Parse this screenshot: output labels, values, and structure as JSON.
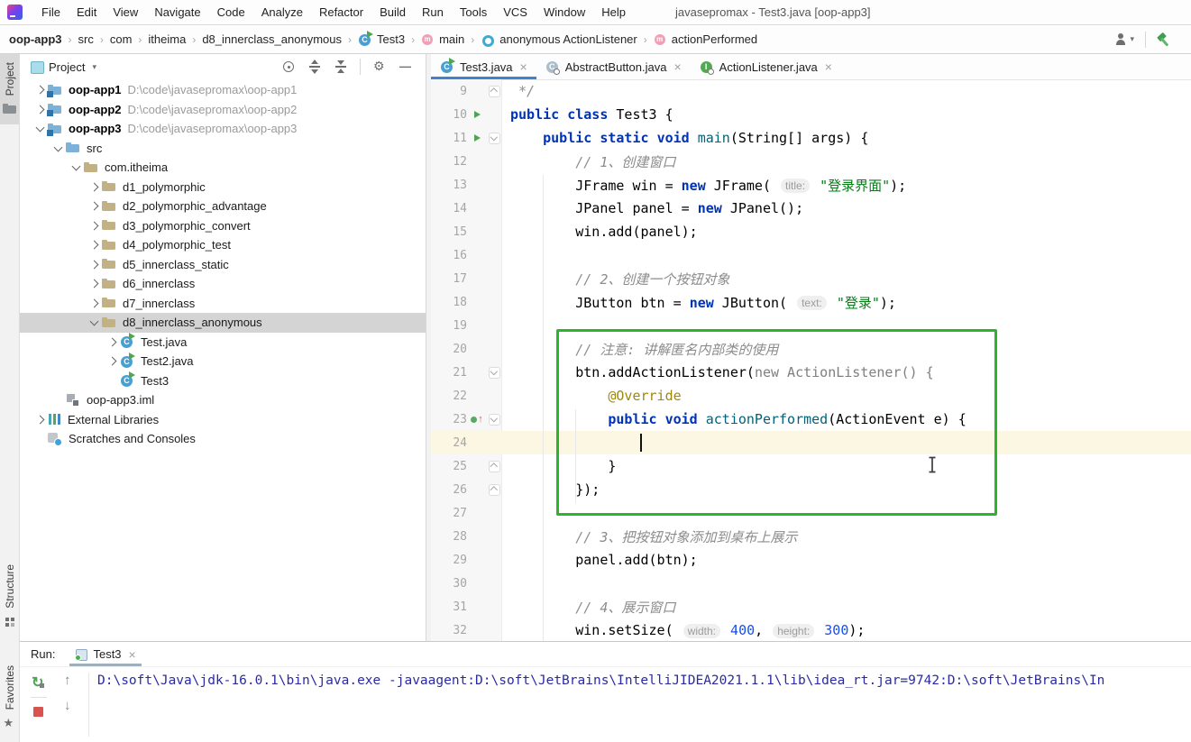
{
  "window": {
    "title": "javasepromax - Test3.java [oop-app3]"
  },
  "menu": {
    "items": [
      "File",
      "Edit",
      "View",
      "Navigate",
      "Code",
      "Analyze",
      "Refactor",
      "Build",
      "Run",
      "Tools",
      "VCS",
      "Window",
      "Help"
    ]
  },
  "breadcrumbs": {
    "items": [
      {
        "label": "oop-app3",
        "icon": null,
        "bold": true
      },
      {
        "label": "src",
        "icon": null
      },
      {
        "label": "com",
        "icon": null
      },
      {
        "label": "itheima",
        "icon": null
      },
      {
        "label": "d8_innerclass_anonymous",
        "icon": null
      },
      {
        "label": "Test3",
        "icon": "class-run"
      },
      {
        "label": "main",
        "icon": "method"
      },
      {
        "label": "anonymous ActionListener",
        "icon": "anonymous-class"
      },
      {
        "label": "actionPerformed",
        "icon": "method"
      }
    ],
    "actions": [
      "user",
      "separator",
      "build-hammer"
    ]
  },
  "stripes": {
    "left_top": [
      {
        "label": "Project",
        "icon": "gray-folder",
        "selected": true
      }
    ],
    "left_bottom": [
      {
        "label": "Structure",
        "icon": "structure"
      },
      {
        "label": "Favorites",
        "icon": "star"
      }
    ]
  },
  "project_panel": {
    "title": "Project",
    "title_caret": "▾",
    "toolbar": [
      "locate",
      "expand-all",
      "collapse-all",
      "separator",
      "settings",
      "hide"
    ],
    "tree": [
      {
        "level": 0,
        "chev": "right",
        "icon": "module",
        "label": "oop-app1",
        "bold": true,
        "path": "D:\\code\\javasepromax\\oop-app1"
      },
      {
        "level": 0,
        "chev": "right",
        "icon": "module",
        "label": "oop-app2",
        "bold": true,
        "path": "D:\\code\\javasepromax\\oop-app2"
      },
      {
        "level": 0,
        "chev": "down",
        "icon": "module",
        "label": "oop-app3",
        "bold": true,
        "path": "D:\\code\\javasepromax\\oop-app3"
      },
      {
        "level": 1,
        "chev": "down",
        "icon": "folder",
        "label": "src"
      },
      {
        "level": 2,
        "chev": "down",
        "icon": "package",
        "label": "com.itheima"
      },
      {
        "level": 3,
        "chev": "right",
        "icon": "package",
        "label": "d1_polymorphic"
      },
      {
        "level": 3,
        "chev": "right",
        "icon": "package",
        "label": "d2_polymorphic_advantage"
      },
      {
        "level": 3,
        "chev": "right",
        "icon": "package",
        "label": "d3_polymorphic_convert"
      },
      {
        "level": 3,
        "chev": "right",
        "icon": "package",
        "label": "d4_polymorphic_test"
      },
      {
        "level": 3,
        "chev": "right",
        "icon": "package",
        "label": "d5_innerclass_static"
      },
      {
        "level": 3,
        "chev": "right",
        "icon": "package",
        "label": "d6_innerclass"
      },
      {
        "level": 3,
        "chev": "right",
        "icon": "package",
        "label": "d7_innerclass"
      },
      {
        "level": 3,
        "chev": "down",
        "icon": "package",
        "label": "d8_innerclass_anonymous",
        "selected": true
      },
      {
        "level": 4,
        "chev": "right",
        "icon": "class-run",
        "label": "Test.java"
      },
      {
        "level": 4,
        "chev": "right",
        "icon": "class-run",
        "label": "Test2.java"
      },
      {
        "level": 4,
        "chev": null,
        "icon": "class-run",
        "label": "Test3"
      },
      {
        "level": 1,
        "chev": null,
        "icon": "iml",
        "label": "oop-app3.iml"
      },
      {
        "level": 0,
        "chev": "right",
        "icon": "libs",
        "label": "External Libraries"
      },
      {
        "level": 0,
        "chev": null,
        "icon": "scratches",
        "label": "Scratches and Consoles"
      }
    ]
  },
  "editor": {
    "tabs": [
      {
        "label": "Test3.java",
        "icon": "class-run",
        "selected": true,
        "close": "×"
      },
      {
        "label": "AbstractButton.java",
        "icon": "abstract-class",
        "selected": false,
        "close": "×"
      },
      {
        "label": "ActionListener.java",
        "icon": "interface",
        "selected": false,
        "close": "×"
      }
    ],
    "caret": {
      "line": 24,
      "col": 16
    },
    "lines": [
      {
        "num": 9,
        "fold": "up",
        "tokens": [
          [
            " */",
            "comment"
          ]
        ]
      },
      {
        "num": 10,
        "run": true,
        "tokens": [
          [
            "public",
            "kw"
          ],
          [
            " ",
            "plain"
          ],
          [
            "class",
            "kw"
          ],
          [
            " Test3 {",
            "plain"
          ]
        ]
      },
      {
        "num": 11,
        "run": true,
        "fold": "down",
        "tokens": [
          [
            "    ",
            "plain"
          ],
          [
            "public",
            "kw"
          ],
          [
            " ",
            "plain"
          ],
          [
            "static",
            "kw"
          ],
          [
            " ",
            "plain"
          ],
          [
            "void",
            "kw"
          ],
          [
            " ",
            "plain"
          ],
          [
            "main",
            "method"
          ],
          [
            "(String[] args) {",
            "plain"
          ]
        ]
      },
      {
        "num": 12,
        "tokens": [
          [
            "        ",
            "plain"
          ],
          [
            "// 1、创建窗口",
            "comment"
          ]
        ]
      },
      {
        "num": 13,
        "tokens": [
          [
            "        JFrame win = ",
            "plain"
          ],
          [
            "new",
            "kw"
          ],
          [
            " JFrame( ",
            "plain"
          ],
          [
            "title:",
            "badge"
          ],
          [
            " ",
            "plain"
          ],
          [
            "\"登录界面\"",
            "str"
          ],
          [
            ");",
            "plain"
          ]
        ]
      },
      {
        "num": 14,
        "tokens": [
          [
            "        JPanel panel = ",
            "plain"
          ],
          [
            "new",
            "kw"
          ],
          [
            " JPanel();",
            "plain"
          ]
        ]
      },
      {
        "num": 15,
        "tokens": [
          [
            "        win.add(panel);",
            "plain"
          ]
        ]
      },
      {
        "num": 16,
        "tokens": []
      },
      {
        "num": 17,
        "tokens": [
          [
            "        ",
            "plain"
          ],
          [
            "// 2、创建一个按钮对象",
            "comment"
          ]
        ]
      },
      {
        "num": 18,
        "tokens": [
          [
            "        JButton btn = ",
            "plain"
          ],
          [
            "new",
            "kw"
          ],
          [
            " JButton( ",
            "plain"
          ],
          [
            "text:",
            "badge"
          ],
          [
            " ",
            "plain"
          ],
          [
            "\"登录\"",
            "str"
          ],
          [
            ");",
            "plain"
          ]
        ]
      },
      {
        "num": 19,
        "tokens": []
      },
      {
        "num": 20,
        "tokens": [
          [
            "        ",
            "plain"
          ],
          [
            "// 注意: 讲解匿名内部类的使用",
            "comment"
          ]
        ]
      },
      {
        "num": 21,
        "fold": "down",
        "tokens": [
          [
            "        btn.addActionListener(",
            "plain"
          ],
          [
            "new ActionListener() {",
            "gray"
          ]
        ]
      },
      {
        "num": 22,
        "tokens": [
          [
            "            ",
            "plain"
          ],
          [
            "@Override",
            "ann"
          ]
        ]
      },
      {
        "num": 23,
        "override": true,
        "fold": "down",
        "tokens": [
          [
            "            ",
            "plain"
          ],
          [
            "public",
            "kw"
          ],
          [
            " ",
            "plain"
          ],
          [
            "void",
            "kw"
          ],
          [
            " ",
            "plain"
          ],
          [
            "actionPerformed",
            "method"
          ],
          [
            "(ActionEvent e) {",
            "plain"
          ]
        ]
      },
      {
        "num": 24,
        "current": true,
        "tokens": []
      },
      {
        "num": 25,
        "fold": "up",
        "tokens": [
          [
            "            }",
            "plain"
          ]
        ]
      },
      {
        "num": 26,
        "fold": "up",
        "tokens": [
          [
            "        });",
            "plain"
          ]
        ]
      },
      {
        "num": 27,
        "tokens": []
      },
      {
        "num": 28,
        "tokens": [
          [
            "        ",
            "plain"
          ],
          [
            "// 3、把按钮对象添加到桌布上展示",
            "comment"
          ]
        ]
      },
      {
        "num": 29,
        "tokens": [
          [
            "        panel.add(btn);",
            "plain"
          ]
        ]
      },
      {
        "num": 30,
        "tokens": []
      },
      {
        "num": 31,
        "tokens": [
          [
            "        ",
            "plain"
          ],
          [
            "// 4、展示窗口",
            "comment"
          ]
        ]
      },
      {
        "num": 32,
        "tokens": [
          [
            "        win.setSize( ",
            "plain"
          ],
          [
            "width:",
            "badge"
          ],
          [
            " ",
            "plain"
          ],
          [
            "400",
            "num"
          ],
          [
            ", ",
            "plain"
          ],
          [
            "height:",
            "badge"
          ],
          [
            " ",
            "plain"
          ],
          [
            "300",
            "num"
          ],
          [
            ");",
            "plain"
          ]
        ]
      }
    ]
  },
  "annotation": {
    "shape": "green-rectangle",
    "color": "#2bb52b"
  },
  "run_panel": {
    "label": "Run:",
    "tab": {
      "label": "Test3",
      "icon": "run-console",
      "close": "×"
    },
    "toolbar_left": [
      "rerun",
      "stop"
    ],
    "toolbar_right": [
      "up",
      "down"
    ],
    "console": "D:\\soft\\Java\\jdk-16.0.1\\bin\\java.exe -javaagent:D:\\soft\\JetBrains\\IntelliJIDEA2021.1.1\\lib\\idea_rt.jar=9742:D:\\soft\\JetBrains\\In"
  },
  "colors": {
    "accent_blue": "#4083c9",
    "annotation_green": "#2bb52b",
    "keyword": "#0033b3",
    "string": "#067d17",
    "comment": "#8c8c8c",
    "number": "#1750eb",
    "method": "#00627a",
    "java_annotation": "#9e880d",
    "console_text": "#2a2aa5",
    "selection_gray": "#d4d4d4",
    "current_line": "#fbf7e3"
  }
}
